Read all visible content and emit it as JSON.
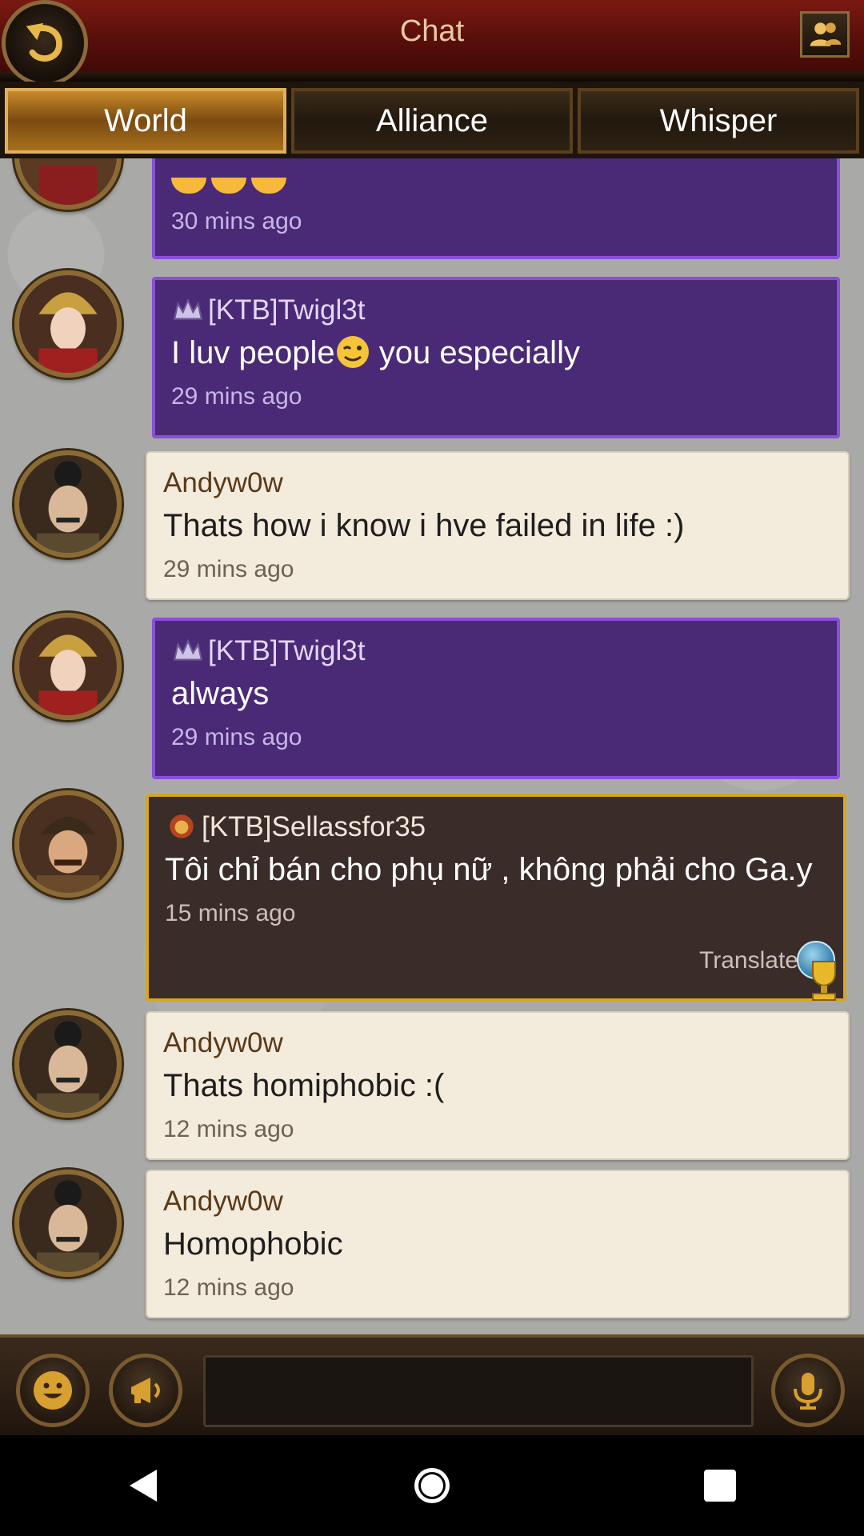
{
  "header": {
    "title": "Chat",
    "back_icon": "back-arrow-icon",
    "friends_icon": "friends-icon"
  },
  "tabs": [
    {
      "label": "World",
      "active": true
    },
    {
      "label": "Alliance",
      "active": false
    },
    {
      "label": "Whisper",
      "active": false
    }
  ],
  "messages": [
    {
      "style": "purple",
      "name": "",
      "text": "",
      "time": "30 mins ago",
      "partial": true
    },
    {
      "style": "purple",
      "name": "[KTB]Twigl3t",
      "text_before": "I luv people",
      "text_after": " you especially",
      "emoji": "wink-emoji",
      "time": "29 mins ago"
    },
    {
      "style": "cream",
      "name": "Andyw0w",
      "text": "Thats how i know i hve failed in life :)",
      "time": "29 mins ago"
    },
    {
      "style": "purple",
      "name": "[KTB]Twigl3t",
      "text": "always",
      "time": "29 mins ago"
    },
    {
      "style": "gold",
      "name": "[KTB]Sellassfor35",
      "text": "Tôi chỉ bán cho phụ nữ , không phải cho Ga.y",
      "time": "15 mins ago",
      "translate_label": "Translate"
    },
    {
      "style": "cream",
      "name": "Andyw0w",
      "text": "Thats homiphobic :(",
      "time": "12 mins ago"
    },
    {
      "style": "cream",
      "name": "Andyw0w",
      "text": "Homophobic",
      "time": "12 mins ago"
    }
  ],
  "input": {
    "value": "",
    "placeholder": ""
  },
  "colors": {
    "purple_bubble": "#4a2a76",
    "cream_bubble": "#f3ebdc",
    "gold_border": "#d6a622"
  }
}
